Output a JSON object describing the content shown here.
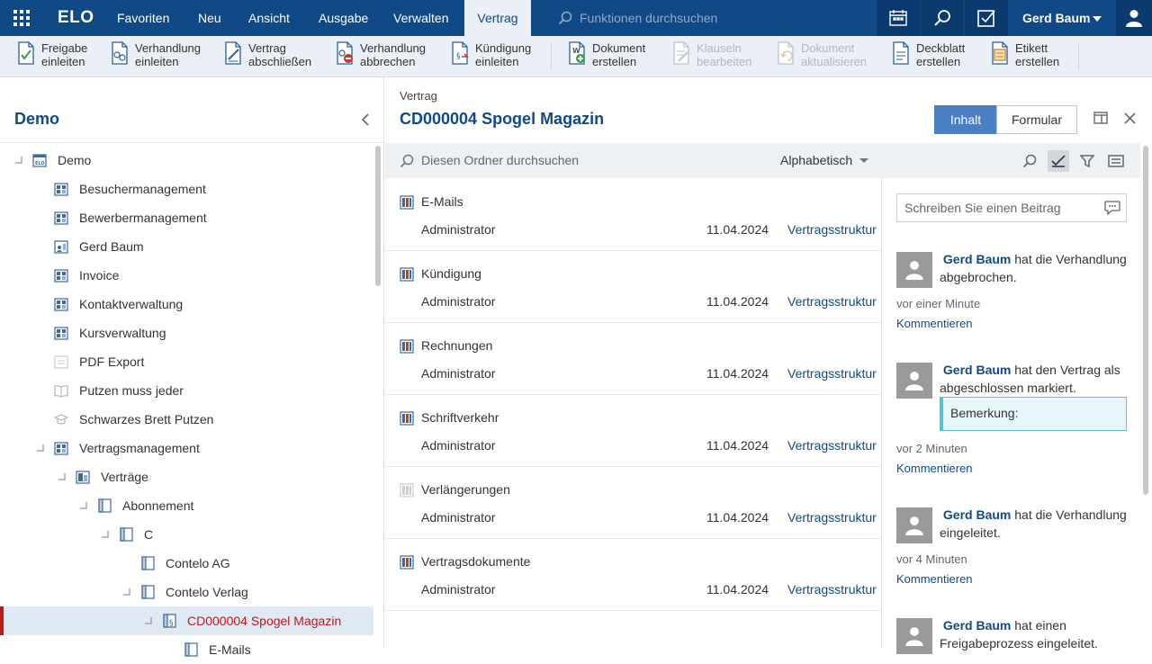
{
  "topbar": {
    "logo": "ELO",
    "menu": [
      "Favoriten",
      "Neu",
      "Ansicht",
      "Ausgabe",
      "Verwalten",
      "Vertrag"
    ],
    "search_placeholder": "Funktionen durchsuchen",
    "user": "Gerd Baum",
    "active_menu": "Vertrag",
    "brand_color": "#0f4a87"
  },
  "ribbon": [
    {
      "line1": "Freigabe",
      "line2": "einleiten",
      "icon": "release-doc-icon",
      "enabled": true
    },
    {
      "line1": "Verhandlung",
      "line2": "einleiten",
      "icon": "negotiation-doc-icon",
      "enabled": true
    },
    {
      "line1": "Vertrag",
      "line2": "abschließen",
      "icon": "contract-sign-icon",
      "enabled": true
    },
    {
      "line1": "Verhandlung",
      "line2": "abbrechen",
      "icon": "negotiation-cancel-icon",
      "enabled": true
    },
    {
      "line1": "Kündigung",
      "line2": "einleiten",
      "icon": "termination-doc-icon",
      "enabled": true
    },
    {
      "line1": "Dokument",
      "line2": "erstellen",
      "icon": "document-add-icon",
      "enabled": true
    },
    {
      "line1": "Klauseln",
      "line2": "bearbeiten",
      "icon": "clauses-edit-icon",
      "enabled": false
    },
    {
      "line1": "Dokument",
      "line2": "aktualisieren",
      "icon": "document-refresh-icon",
      "enabled": false
    },
    {
      "line1": "Deckblatt",
      "line2": "erstellen",
      "icon": "cover-sheet-icon",
      "enabled": true
    },
    {
      "line1": "Etikett",
      "line2": "erstellen",
      "icon": "label-icon",
      "enabled": true
    }
  ],
  "tree": {
    "title": "Demo",
    "items": [
      {
        "label": "Demo",
        "level": 0,
        "state": "expanded",
        "icon": "repository-icon"
      },
      {
        "label": "Besuchermanagement",
        "level": 1,
        "state": "collapsed",
        "icon": "solution-folder-icon"
      },
      {
        "label": "Bewerbermanagement",
        "level": 1,
        "state": "collapsed",
        "icon": "solution-folder-icon"
      },
      {
        "label": "Gerd Baum",
        "level": 1,
        "state": "collapsed",
        "icon": "user-folder-icon"
      },
      {
        "label": "Invoice",
        "level": 1,
        "state": "collapsed",
        "icon": "solution-folder-icon"
      },
      {
        "label": "Kontaktverwaltung",
        "level": 1,
        "state": "collapsed",
        "icon": "solution-folder-icon"
      },
      {
        "label": "Kursverwaltung",
        "level": 1,
        "state": "collapsed",
        "icon": "solution-folder-icon"
      },
      {
        "label": "PDF Export",
        "level": 1,
        "state": "leaf",
        "icon": "pale-folder-icon"
      },
      {
        "label": "Putzen muss jeder",
        "level": 1,
        "state": "leaf",
        "icon": "book-folder-icon"
      },
      {
        "label": "Schwarzes Brett Putzen",
        "level": 1,
        "state": "leaf",
        "icon": "cap-folder-icon"
      },
      {
        "label": "Vertragsmanagement",
        "level": 1,
        "state": "expanded",
        "icon": "solution-folder-icon"
      },
      {
        "label": "Verträge",
        "level": 2,
        "state": "expanded",
        "icon": "contracts-folder-icon"
      },
      {
        "label": "Abonnement",
        "level": 3,
        "state": "expanded",
        "icon": "register-folder-icon"
      },
      {
        "label": "C",
        "level": 4,
        "state": "expanded",
        "icon": "register-folder-icon"
      },
      {
        "label": "Contelo AG",
        "level": 5,
        "state": "collapsed",
        "icon": "register-folder-icon"
      },
      {
        "label": "Contelo Verlag",
        "level": 5,
        "state": "expanded",
        "icon": "register-folder-icon"
      },
      {
        "label": "CD000004 Spogel Magazin",
        "level": 6,
        "state": "expanded",
        "icon": "contract-folder-icon",
        "selected": true
      },
      {
        "label": "E-Mails",
        "level": 7,
        "state": "collapsed",
        "icon": "register-folder-icon"
      }
    ]
  },
  "main": {
    "breadcrumb": "Vertrag",
    "title": "CD000004 Spogel Magazin",
    "tabs": [
      "Inhalt",
      "Formular"
    ],
    "active_tab": "Inhalt",
    "search_placeholder": "Diesen Ordner durchsuchen",
    "sort": "Alphabetisch",
    "items": [
      {
        "name": "E-Mails",
        "owner": "Administrator",
        "date": "11.04.2024",
        "structure": "Vertragsstruktur",
        "pale": false
      },
      {
        "name": "Kündigung",
        "owner": "Administrator",
        "date": "11.04.2024",
        "structure": "Vertragsstruktur",
        "pale": false
      },
      {
        "name": "Rechnungen",
        "owner": "Administrator",
        "date": "11.04.2024",
        "structure": "Vertragsstruktur",
        "pale": false
      },
      {
        "name": "Schriftverkehr",
        "owner": "Administrator",
        "date": "11.04.2024",
        "structure": "Vertragsstruktur",
        "pale": false
      },
      {
        "name": "Verlängerungen",
        "owner": "Administrator",
        "date": "11.04.2024",
        "structure": "Vertragsstruktur",
        "pale": true
      },
      {
        "name": "Vertragsdokumente",
        "owner": "Administrator",
        "date": "11.04.2024",
        "structure": "Vertragsstruktur",
        "pale": false
      }
    ]
  },
  "feed": {
    "input_placeholder": "Schreiben Sie einen Beitrag",
    "posts": [
      {
        "author": "Gerd Baum",
        "text": "hat die Verhandlung abgebrochen.",
        "when": "vor einer Minute",
        "comment": "Kommentieren"
      },
      {
        "author": "Gerd Baum",
        "text": "hat den Vertrag als abgeschlossen markiert.",
        "remark": "Bemerkung:",
        "when": "vor 2 Minuten",
        "comment": "Kommentieren"
      },
      {
        "author": "Gerd Baum",
        "text": "hat die Verhandlung eingeleitet.",
        "when": "vor 4 Minuten",
        "comment": "Kommentieren"
      },
      {
        "author": "Gerd Baum",
        "text": "hat einen Freigabeprozess eingeleitet."
      }
    ]
  }
}
